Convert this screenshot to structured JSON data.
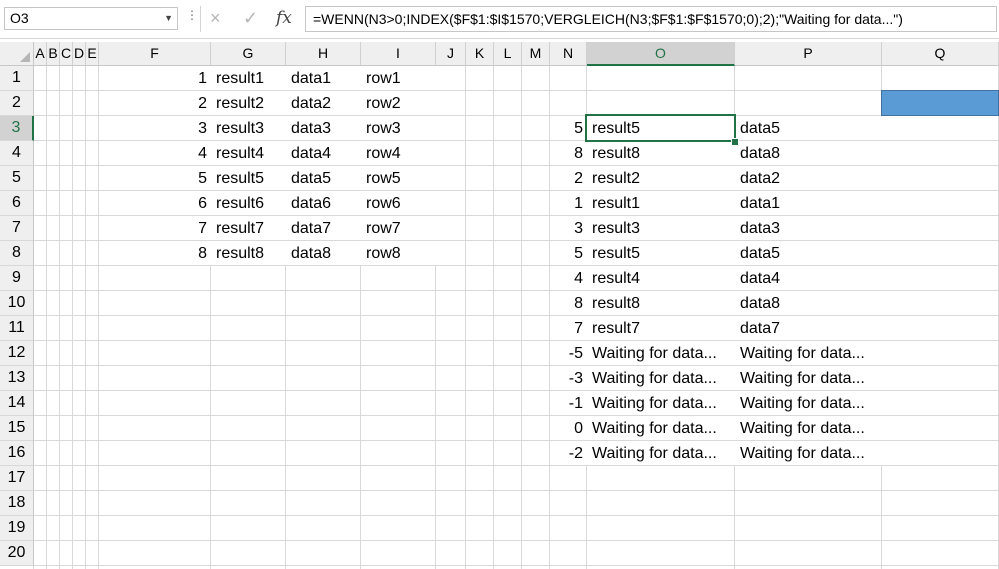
{
  "formula_bar": {
    "name_box": "O3",
    "formula": "=WENN(N3>0;INDEX($F$1:$I$1570;VERGLEICH(N3;$F$1:$F$1570;0);2);\"Waiting for data...\")",
    "cancel_icon": "×",
    "enter_icon": "✓",
    "fx_icon": "fx"
  },
  "columns": [
    "A",
    "B",
    "C",
    "D",
    "E",
    "F",
    "G",
    "H",
    "I",
    "J",
    "K",
    "L",
    "M",
    "N",
    "O",
    "P",
    "Q"
  ],
  "rows": [
    "1",
    "2",
    "3",
    "4",
    "5",
    "6",
    "7",
    "8",
    "9",
    "10",
    "11",
    "12",
    "13",
    "14",
    "15",
    "16",
    "17",
    "18",
    "19",
    "20"
  ],
  "left_table": [
    {
      "f": "1",
      "g": "result1",
      "h": "data1",
      "i": "row1"
    },
    {
      "f": "2",
      "g": "result2",
      "h": "data2",
      "i": "row2"
    },
    {
      "f": "3",
      "g": "result3",
      "h": "data3",
      "i": "row3"
    },
    {
      "f": "4",
      "g": "result4",
      "h": "data4",
      "i": "row4"
    },
    {
      "f": "5",
      "g": "result5",
      "h": "data5",
      "i": "row5"
    },
    {
      "f": "6",
      "g": "result6",
      "h": "data6",
      "i": "row6"
    },
    {
      "f": "7",
      "g": "result7",
      "h": "data7",
      "i": "row7"
    },
    {
      "f": "8",
      "g": "result8",
      "h": "data8",
      "i": "row8"
    }
  ],
  "right_table": [
    {
      "n": "5",
      "o": "result5",
      "p": "data5"
    },
    {
      "n": "8",
      "o": "result8",
      "p": "data8"
    },
    {
      "n": "2",
      "o": "result2",
      "p": "data2"
    },
    {
      "n": "1",
      "o": "result1",
      "p": "data1"
    },
    {
      "n": "3",
      "o": "result3",
      "p": "data3"
    },
    {
      "n": "5",
      "o": "result5",
      "p": "data5"
    },
    {
      "n": "4",
      "o": "result4",
      "p": "data4"
    },
    {
      "n": "8",
      "o": "result8",
      "p": "data8"
    },
    {
      "n": "7",
      "o": "result7",
      "p": "data7"
    },
    {
      "n": "-5",
      "o": "Waiting for data...",
      "p": "Waiting for data..."
    },
    {
      "n": "-3",
      "o": "Waiting for data...",
      "p": "Waiting for data..."
    },
    {
      "n": "-1",
      "o": "Waiting for data...",
      "p": "Waiting for data..."
    },
    {
      "n": "0",
      "o": "Waiting for data...",
      "p": "Waiting for data..."
    },
    {
      "n": "-2",
      "o": "Waiting for data...",
      "p": "Waiting for data..."
    }
  ],
  "selected_cell": "O3",
  "colors": {
    "accent": "#217346",
    "fill_q2": "#5b9bd5"
  }
}
